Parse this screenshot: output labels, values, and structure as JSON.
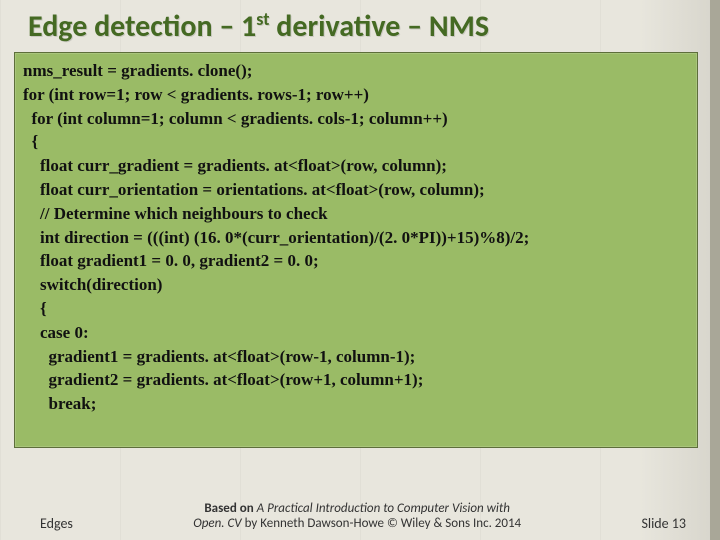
{
  "title_html": "Edge detection – 1<sup>st</sup> derivative – NMS",
  "code": [
    "nms_result = gradients. clone();",
    "for (int row=1; row < gradients. rows-1; row++)",
    "  for (int column=1; column < gradients. cols-1; column++)",
    "  {",
    "    float curr_gradient = gradients. at<float>(row, column);",
    "    float curr_orientation = orientations. at<float>(row, column);",
    "    // Determine which neighbours to check",
    "    int direction = (((int) (16. 0*(curr_orientation)/(2. 0*PI))+15)%8)/2;",
    "    float gradient1 = 0. 0, gradient2 = 0. 0;",
    "    switch(direction)",
    "    {",
    "    case 0:",
    "      gradient1 = gradients. at<float>(row-1, column-1);",
    "      gradient2 = gradients. at<float>(row+1, column+1);",
    "      break;"
  ],
  "footer": {
    "left": "Edges",
    "center_line1_prefix": "Based on",
    "center_line1_ital": "A Practical Introduction to Computer Vision with",
    "center_line2_ital": "Open. CV",
    "center_line2_rest": " by Kenneth Dawson-Howe © Wiley & Sons Inc. 2014",
    "right": "Slide 13"
  }
}
